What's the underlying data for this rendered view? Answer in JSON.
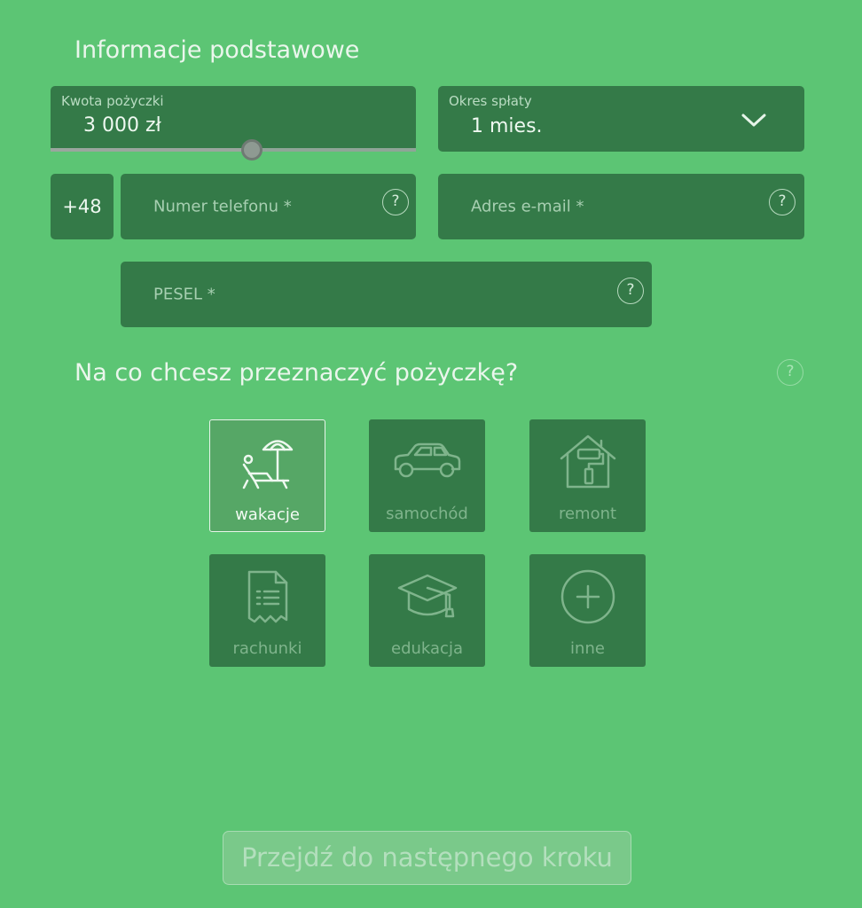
{
  "section_basic": {
    "title": "Informacje podstawowe"
  },
  "loan_amount": {
    "label": "Kwota pożyczki",
    "value": "3 000 zł",
    "slider_fraction": 0.55
  },
  "repayment_period": {
    "label": "Okres spłaty",
    "value": "1 mies."
  },
  "phone": {
    "prefix": "+48",
    "placeholder": "Numer telefonu *"
  },
  "email": {
    "placeholder": "Adres e-mail *"
  },
  "pesel": {
    "placeholder": "PESEL *"
  },
  "help_symbol": "?",
  "section_purpose": {
    "title": "Na co chcesz przeznaczyć pożyczkę?"
  },
  "purposes": [
    {
      "label": "wakacje",
      "icon": "beach-chair-umbrella-icon",
      "selected": true
    },
    {
      "label": "samochód",
      "icon": "car-icon",
      "selected": false
    },
    {
      "label": "remont",
      "icon": "house-paint-roller-icon",
      "selected": false
    },
    {
      "label": "rachunki",
      "icon": "receipt-icon",
      "selected": false
    },
    {
      "label": "edukacja",
      "icon": "graduation-cap-icon",
      "selected": false
    },
    {
      "label": "inne",
      "icon": "plus-circle-icon",
      "selected": false
    }
  ],
  "next_button": {
    "label": "Przejdź do następnego kroku"
  },
  "colors": {
    "background": "#5cc574",
    "field": "#347a48",
    "tile_selected": "#56a766"
  }
}
